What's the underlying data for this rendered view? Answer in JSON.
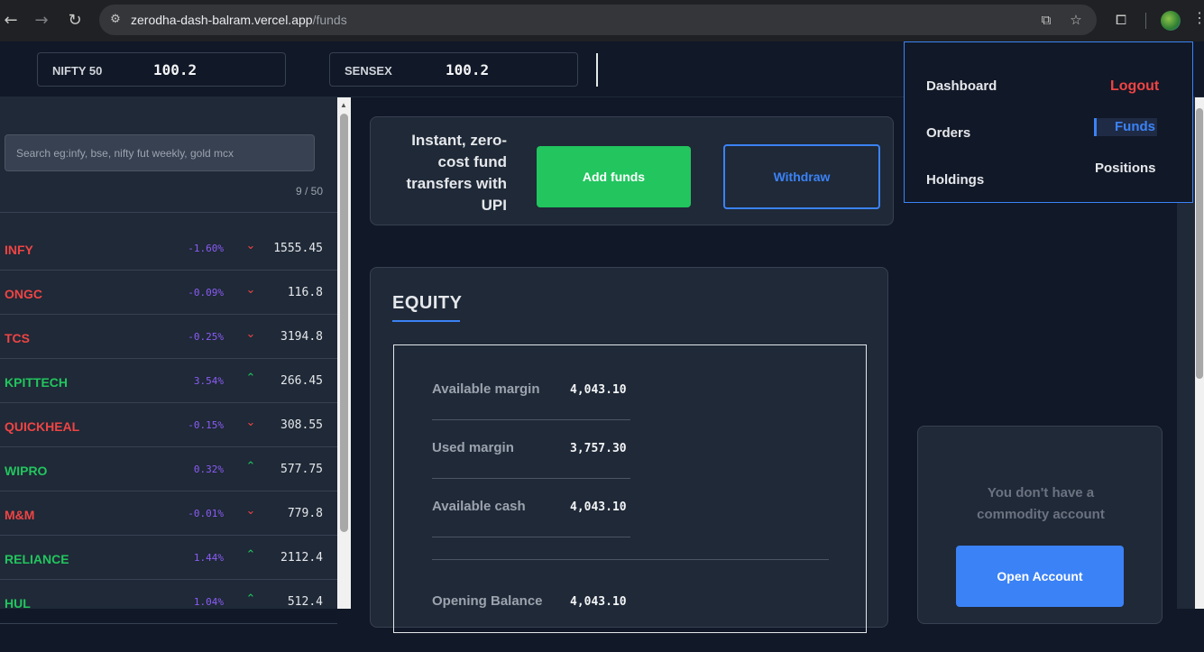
{
  "browser": {
    "url_host": "zerodha-dash-balram.vercel.app",
    "url_path": "/funds",
    "icons": [
      "back-arrow-icon",
      "forward-arrow-icon",
      "reload-icon",
      "site-settings-icon",
      "install-app-icon",
      "bookmark-star-icon",
      "extensions-icon",
      "profile-avatar-icon",
      "more-menu-icon"
    ]
  },
  "indices": [
    {
      "name": "NIFTY 50",
      "value": "100.2"
    },
    {
      "name": "SENSEX",
      "value": "100.2"
    }
  ],
  "menu": {
    "dashboard": "Dashboard",
    "orders": "Orders",
    "holdings": "Holdings",
    "logout": "Logout",
    "funds": "Funds",
    "positions": "Positions"
  },
  "watchlist": {
    "search_placeholder": "Search eg:infy, bse, nifty fut weekly, gold mcx",
    "count": "9 / 50",
    "items": [
      {
        "symbol": "INFY",
        "change": "-1.60%",
        "direction": "down",
        "price": "1555.45"
      },
      {
        "symbol": "ONGC",
        "change": "-0.09%",
        "direction": "down",
        "price": "116.8"
      },
      {
        "symbol": "TCS",
        "change": "-0.25%",
        "direction": "down",
        "price": "3194.8"
      },
      {
        "symbol": "KPITTECH",
        "change": "3.54%",
        "direction": "up",
        "price": "266.45"
      },
      {
        "symbol": "QUICKHEAL",
        "change": "-0.15%",
        "direction": "down",
        "price": "308.55"
      },
      {
        "symbol": "WIPRO",
        "change": "0.32%",
        "direction": "up",
        "price": "577.75"
      },
      {
        "symbol": "M&M",
        "change": "-0.01%",
        "direction": "down",
        "price": "779.8"
      },
      {
        "symbol": "RELIANCE",
        "change": "1.44%",
        "direction": "up",
        "price": "2112.4"
      },
      {
        "symbol": "HUL",
        "change": "1.04%",
        "direction": "up",
        "price": "512.4"
      }
    ]
  },
  "funds": {
    "upi_text": "Instant, zero-cost fund transfers with UPI",
    "add_funds": "Add funds",
    "withdraw": "Withdraw"
  },
  "equity": {
    "title": "EQUITY",
    "rows": [
      {
        "label": "Available margin",
        "value": "4,043.10"
      },
      {
        "label": "Used margin",
        "value": "3,757.30"
      },
      {
        "label": "Available cash",
        "value": "4,043.10"
      },
      {
        "label": "Opening Balance",
        "value": "4,043.10"
      }
    ]
  },
  "commodity": {
    "message": "You don't have a commodity account",
    "open_account": "Open Account"
  },
  "colors": {
    "negative": "#ef4444",
    "positive": "#22c55e",
    "change_percent": "#8b5cf6",
    "accent": "#3b82f6",
    "add_funds": "#22c55e"
  }
}
